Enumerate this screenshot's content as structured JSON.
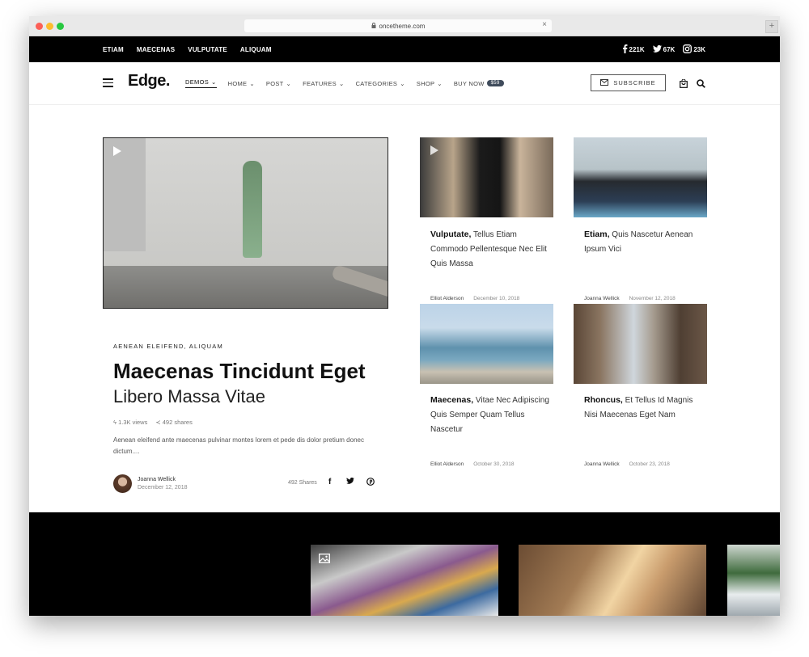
{
  "browser": {
    "url": "oncetheme.com"
  },
  "topbar": {
    "nav": [
      "ETIAM",
      "MAECENAS",
      "VULPUTATE",
      "ALIQUAM"
    ],
    "social": [
      {
        "icon": "facebook-icon",
        "count": "221K"
      },
      {
        "icon": "twitter-icon",
        "count": "67K"
      },
      {
        "icon": "instagram-icon",
        "count": "23K"
      }
    ]
  },
  "header": {
    "logo": "Edge.",
    "nav": [
      {
        "label": "DEMOS",
        "active": true
      },
      {
        "label": "HOME"
      },
      {
        "label": "POST"
      },
      {
        "label": "FEATURES"
      },
      {
        "label": "CATEGORIES"
      },
      {
        "label": "SHOP"
      },
      {
        "label": "BUY NOW",
        "badge": "$59"
      }
    ],
    "subscribe_label": "SUBSCRIBE"
  },
  "hero": {
    "category": "AENEAN ELEIFEND, ALIQUAM",
    "title": "Maecenas Tincidunt Eget",
    "subtitle": "Libero Massa Vitae",
    "views": "1.3K views",
    "shares": "492 shares",
    "excerpt": "Aenean eleifend ante maecenas pulvinar montes lorem et pede dis dolor pretium donec dictum....",
    "author": "Joanna Wellick",
    "date": "December 12, 2018",
    "share_count": "492 Shares"
  },
  "cards": [
    {
      "title_bold": "Vulputate,",
      "title_rest": " Tellus Etiam Commodo Pellentesque Nec Elit Quis Massa",
      "author": "Elliot Alderson",
      "date": "December 10, 2018"
    },
    {
      "title_bold": "Etiam,",
      "title_rest": " Quis Nascetur Aenean Ipsum Vici",
      "author": "Joanna Wellick",
      "date": "November 12, 2018"
    },
    {
      "title_bold": "Maecenas,",
      "title_rest": " Vitae Nec Adipiscing Quis Semper Quam Tellus Nascetur",
      "author": "Elliot Alderson",
      "date": "October 30, 2018"
    },
    {
      "title_bold": "Rhoncus,",
      "title_rest": " Et Tellus Id Magnis Nisi Maecenas Eget Nam",
      "author": "Joanna Wellick",
      "date": "October 23, 2018"
    }
  ]
}
